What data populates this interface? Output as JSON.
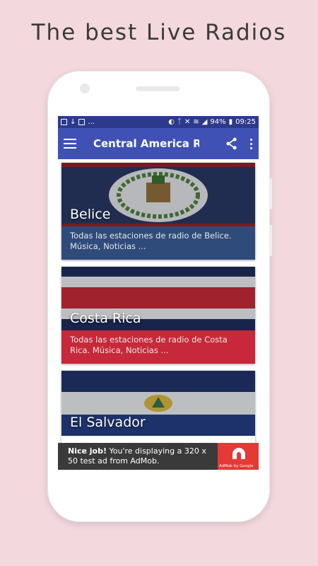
{
  "headline": "The best Live Radios",
  "status_bar": {
    "left_dots": "...",
    "battery": "94%",
    "time": "09:25"
  },
  "app_bar": {
    "title": "Central America Ra…",
    "menu_icon": "hamburger-menu-icon",
    "share_icon": "share-icon",
    "more_icon": "more-vert-icon"
  },
  "countries": [
    {
      "name": "Belice",
      "description": "Todas las estaciones de radio de Belice. Música, Noticias ...",
      "desc_color": "#2f4b7a"
    },
    {
      "name": "Costa Rica",
      "description": "Todas las estaciones de radio de Costa Rica. Música, Noticias ...",
      "desc_color": "#c7283a"
    },
    {
      "name": "El Salvador",
      "description": "",
      "desc_color": "#2c4f9a"
    }
  ],
  "ad": {
    "bold": "Nice job!",
    "text": " You're displaying a 320 x 50 test ad from AdMob.",
    "logo_caption": "AdMob by Google",
    "accent": "#e53935"
  },
  "colors": {
    "background": "#f3d8de",
    "status_bar": "#2d3a8c",
    "app_bar": "#3f51b5"
  }
}
